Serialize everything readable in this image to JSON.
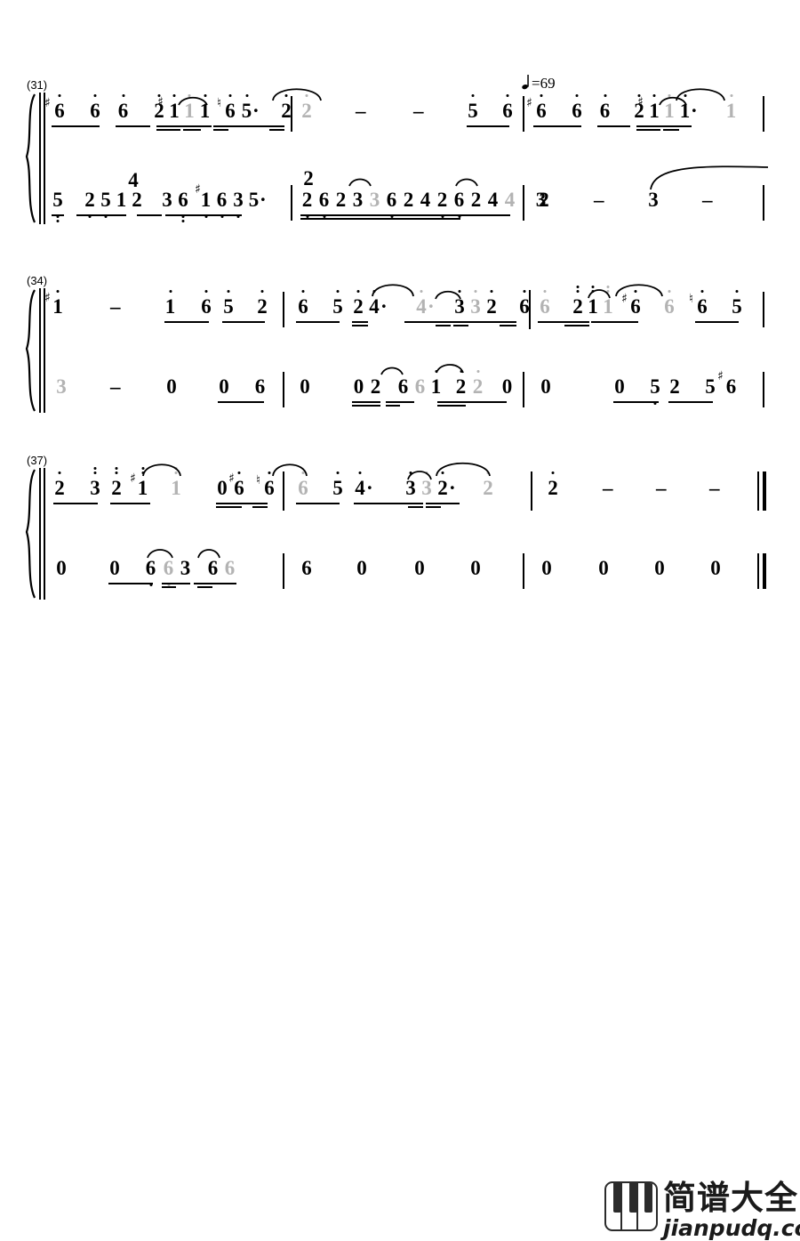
{
  "document": {
    "type": "jianpu-numbered-notation-sheet-music",
    "tempo": {
      "symbol": "quarter-note",
      "equals": "=69",
      "text": "=69"
    }
  },
  "systems": [
    {
      "label": "(31)",
      "treble": {
        "measures": [
          {
            "notes": [
              {
                "d": "6",
                "acc": "#",
                "oct": 1,
                "beam": 1
              },
              {
                "d": "6",
                "oct": 1,
                "beam": 1
              },
              {
                "d": "6",
                "oct": 1,
                "beam": 1
              },
              {
                "d": "2",
                "acc": "#",
                "oct": 1,
                "beam": 2
              },
              {
                "d": "1",
                "oct": 1,
                "beam": 2
              },
              {
                "d": "1",
                "oct": 1,
                "beam": 2,
                "tied": true
              },
              {
                "d": "1",
                "oct": 1,
                "beam": 2
              },
              {
                "d": "6",
                "acc": "b",
                "oct": 1,
                "beam": 1
              },
              {
                "d": "5",
                "oct": 1,
                "beam": 1,
                "dot": true
              },
              {
                "d": "2",
                "oct": 1,
                "beam": 2
              }
            ]
          },
          {
            "notes": [
              {
                "d": "2",
                "oct": 1,
                "tied": true
              },
              {
                "d": "-"
              },
              {
                "d": "-"
              },
              {
                "d": "5",
                "oct": 1,
                "beam": 1
              },
              {
                "d": "6",
                "oct": 1,
                "beam": 1
              }
            ]
          },
          {
            "notes": [
              {
                "d": "6",
                "acc": "#",
                "oct": 1,
                "beam": 1
              },
              {
                "d": "6",
                "oct": 1,
                "beam": 1
              },
              {
                "d": "6",
                "oct": 1,
                "beam": 1
              },
              {
                "d": "2",
                "acc": "#",
                "oct": 1,
                "beam": 2
              },
              {
                "d": "1",
                "oct": 1,
                "beam": 2
              },
              {
                "d": "1",
                "oct": 1,
                "beam": 2,
                "tied": true
              },
              {
                "d": "1",
                "oct": 1,
                "beam": 1,
                "dot": true
              },
              {
                "d": "1",
                "oct": 1,
                "tied": true
              }
            ]
          }
        ]
      },
      "bass": {
        "measures": [
          {
            "top_number": "4",
            "notes": [
              {
                "d": "5",
                "oct": -2,
                "beam": 1
              },
              {
                "d": "2",
                "oct": -1,
                "beam": 1
              },
              {
                "d": "5",
                "oct": -1,
                "beam": 1
              },
              {
                "d": "1",
                "oct": 0,
                "beam": 1
              },
              {
                "d": "2",
                "beam": 1
              },
              {
                "d": "3",
                "beam": 1
              },
              {
                "d": "6",
                "oct": -2,
                "beam": 1
              },
              {
                "d": "1",
                "acc": "#",
                "oct": -1,
                "beam": 1
              },
              {
                "d": "6",
                "oct": -1,
                "beam": 1
              },
              {
                "d": "3",
                "oct": -1,
                "beam": 1
              },
              {
                "d": "5",
                "beam": 1,
                "dot": true
              }
            ]
          },
          {
            "top_number": "2",
            "notes": [
              {
                "d": "2",
                "oct": -1,
                "beam": 2
              },
              {
                "d": "6",
                "oct": -1,
                "beam": 2
              },
              {
                "d": "2",
                "beam": 2
              },
              {
                "d": "3",
                "beam": 2
              },
              {
                "d": "3",
                "beam": 2,
                "tied": true
              },
              {
                "d": "6",
                "oct": -1,
                "beam": 2
              },
              {
                "d": "2",
                "beam": 2
              },
              {
                "d": "4",
                "beam": 2
              },
              {
                "d": "2",
                "oct": -1,
                "beam": 2
              },
              {
                "d": "6",
                "oct": -1,
                "beam": 2
              },
              {
                "d": "2",
                "beam": 2
              },
              {
                "d": "4",
                "beam": 2
              },
              {
                "d": "4",
                "beam": 1,
                "tied": true
              },
              {
                "d": "3",
                "beam": 1
              }
            ]
          },
          {
            "notes": [
              {
                "d": "2"
              },
              {
                "d": "-"
              },
              {
                "d": "3"
              },
              {
                "d": "-"
              }
            ]
          }
        ]
      }
    },
    {
      "label": "(34)",
      "treble": {
        "measures": [
          {
            "notes": [
              {
                "d": "1",
                "acc": "#",
                "oct": 1
              },
              {
                "d": "-"
              },
              {
                "d": "1",
                "oct": 1,
                "beam": 1
              },
              {
                "d": "6",
                "oct": 1,
                "beam": 1
              },
              {
                "d": "5",
                "oct": 1,
                "beam": 1
              },
              {
                "d": "2",
                "oct": 1,
                "beam": 1
              }
            ]
          },
          {
            "notes": [
              {
                "d": "6",
                "oct": 1,
                "beam": 1
              },
              {
                "d": "5",
                "oct": 1,
                "beam": 1
              },
              {
                "d": "2",
                "oct": 1,
                "beam": 2
              },
              {
                "d": "4",
                "oct": 1,
                "beam": 1,
                "dot": true
              },
              {
                "d": "4",
                "oct": 1,
                "tied": true,
                "dot": true
              },
              {
                "d": "3",
                "oct": 1,
                "beam": 2
              },
              {
                "d": "3",
                "oct": 1,
                "beam": 2,
                "tied": true
              },
              {
                "d": "2",
                "oct": 1,
                "beam": 1
              },
              {
                "d": "6",
                "oct": 1,
                "beam": 1
              }
            ]
          },
          {
            "notes": [
              {
                "d": "6",
                "oct": 1,
                "beam": 1,
                "tied": true
              },
              {
                "d": "2",
                "oct": 2,
                "beam": 2
              },
              {
                "d": "1",
                "oct": 2,
                "beam": 2
              },
              {
                "d": "1",
                "oct": 2,
                "beam": 1,
                "tied": true
              },
              {
                "d": "6",
                "acc": "#",
                "oct": 1,
                "beam": 1
              },
              {
                "d": "6",
                "oct": 1,
                "tied": true
              },
              {
                "d": "6",
                "acc": "n",
                "oct": 1,
                "beam": 1
              },
              {
                "d": "5",
                "oct": 1,
                "beam": 1
              }
            ]
          }
        ]
      },
      "bass": {
        "measures": [
          {
            "notes": [
              {
                "d": "3",
                "tied": true
              },
              {
                "d": "-"
              },
              {
                "d": "0"
              },
              {
                "d": "0",
                "beam": 1
              },
              {
                "d": "6",
                "beam": 1
              }
            ]
          },
          {
            "notes": [
              {
                "d": "0"
              },
              {
                "d": "0",
                "beam": 2
              },
              {
                "d": "2",
                "beam": 2
              },
              {
                "d": "6",
                "beam": 2
              },
              {
                "d": "6",
                "beam": 2,
                "tied": true
              },
              {
                "d": "1",
                "oct": 1
              },
              {
                "d": "2",
                "oct": 1,
                "beam": 2
              },
              {
                "d": "2",
                "oct": 1,
                "beam": 2,
                "tied": true
              },
              {
                "d": "0",
                "beam": 1
              }
            ]
          },
          {
            "notes": [
              {
                "d": "0"
              },
              {
                "d": "0",
                "beam": 1
              },
              {
                "d": "5",
                "oct": -1,
                "beam": 1
              },
              {
                "d": "2",
                "beam": 1
              },
              {
                "d": "5",
                "beam": 1
              },
              {
                "d": "6",
                "acc": "#"
              }
            ]
          }
        ]
      }
    },
    {
      "label": "(37)",
      "treble": {
        "measures": [
          {
            "notes": [
              {
                "d": "2",
                "oct": 1,
                "beam": 1
              },
              {
                "d": "3",
                "oct": 2,
                "beam": 1
              },
              {
                "d": "2",
                "oct": 2,
                "beam": 1
              },
              {
                "d": "1",
                "acc": "#",
                "oct": 2,
                "beam": 1
              },
              {
                "d": "1",
                "oct": 2,
                "tied": true
              },
              {
                "d": "0",
                "beam": 2
              },
              {
                "d": "6",
                "acc": "#",
                "oct": 1,
                "beam": 2
              },
              {
                "d": "6",
                "acc": "n",
                "oct": 1,
                "beam": 2
              }
            ]
          },
          {
            "notes": [
              {
                "d": "6",
                "oct": 1,
                "beam": 1,
                "tied": true
              },
              {
                "d": "5",
                "oct": 1,
                "beam": 1
              },
              {
                "d": "4",
                "oct": 1,
                "beam": 1,
                "dot": true
              },
              {
                "d": "3",
                "oct": 1,
                "beam": 2
              },
              {
                "d": "3",
                "oct": 1,
                "beam": 2,
                "tied": true
              },
              {
                "d": "2",
                "oct": 1,
                "beam": 1,
                "dot": true
              },
              {
                "d": "2",
                "oct": 1,
                "tied": true
              }
            ]
          },
          {
            "notes": [
              {
                "d": "2",
                "oct": 1
              },
              {
                "d": "-"
              },
              {
                "d": "-"
              },
              {
                "d": "-"
              }
            ]
          }
        ]
      },
      "bass": {
        "measures": [
          {
            "notes": [
              {
                "d": "0"
              },
              {
                "d": "0",
                "beam": 1
              },
              {
                "d": "6",
                "oct": -1,
                "beam": 1
              },
              {
                "d": "6",
                "oct": -1,
                "beam": 2,
                "tied": true
              },
              {
                "d": "3",
                "beam": 2
              },
              {
                "d": "6",
                "beam": 2
              },
              {
                "d": "6",
                "tied": true
              }
            ]
          },
          {
            "notes": [
              {
                "d": "6"
              },
              {
                "d": "0"
              },
              {
                "d": "0"
              },
              {
                "d": "0"
              }
            ]
          },
          {
            "notes": [
              {
                "d": "0"
              },
              {
                "d": "0"
              },
              {
                "d": "0"
              },
              {
                "d": "0"
              }
            ]
          }
        ]
      }
    }
  ],
  "watermark": {
    "cn": "简谱大全",
    "url": "jianpudq.com"
  }
}
